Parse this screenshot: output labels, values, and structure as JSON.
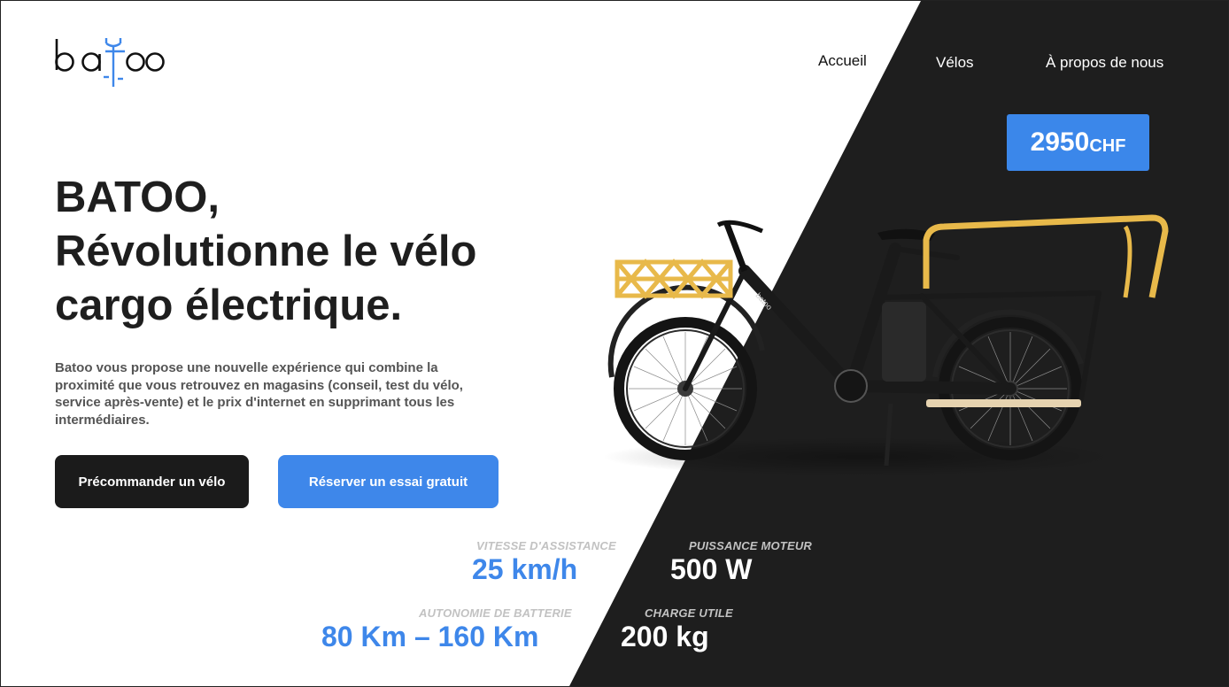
{
  "brand": {
    "logo_text": "batoo"
  },
  "nav": {
    "home": "Accueil",
    "bikes": "Vélos",
    "about": "À propos de nous"
  },
  "price": {
    "amount": "2950",
    "currency": "CHF"
  },
  "hero": {
    "line1": "BATOO,",
    "line2": "Révolutionne le vélo",
    "line3": "cargo électrique.",
    "description": "Batoo vous propose une nouvelle expérience qui combine la proximité que vous retrouvez en magasins (conseil, test du vélo, service après-vente) et le prix d'internet en supprimant tous les intermédiaires."
  },
  "buttons": {
    "preorder": "Précommander un vélo",
    "trial": "Réserver un essai gratuit"
  },
  "specs": {
    "speed": {
      "label": "VITESSE D'ASSISTANCE",
      "value": "25 km/h"
    },
    "power": {
      "label": "PUISSANCE MOTEUR",
      "value": "500 W"
    },
    "range": {
      "label": "AUTONOMIE DE BATTERIE",
      "value": "80 Km – 160 Km"
    },
    "load": {
      "label": "CHARGE UTILE",
      "value": "200 kg"
    }
  },
  "bike_image": {
    "frame_text": "batoo"
  },
  "colors": {
    "accent": "#3e87ea",
    "dark": "#1e1e1e",
    "rack_yellow": "#e8b94a"
  }
}
